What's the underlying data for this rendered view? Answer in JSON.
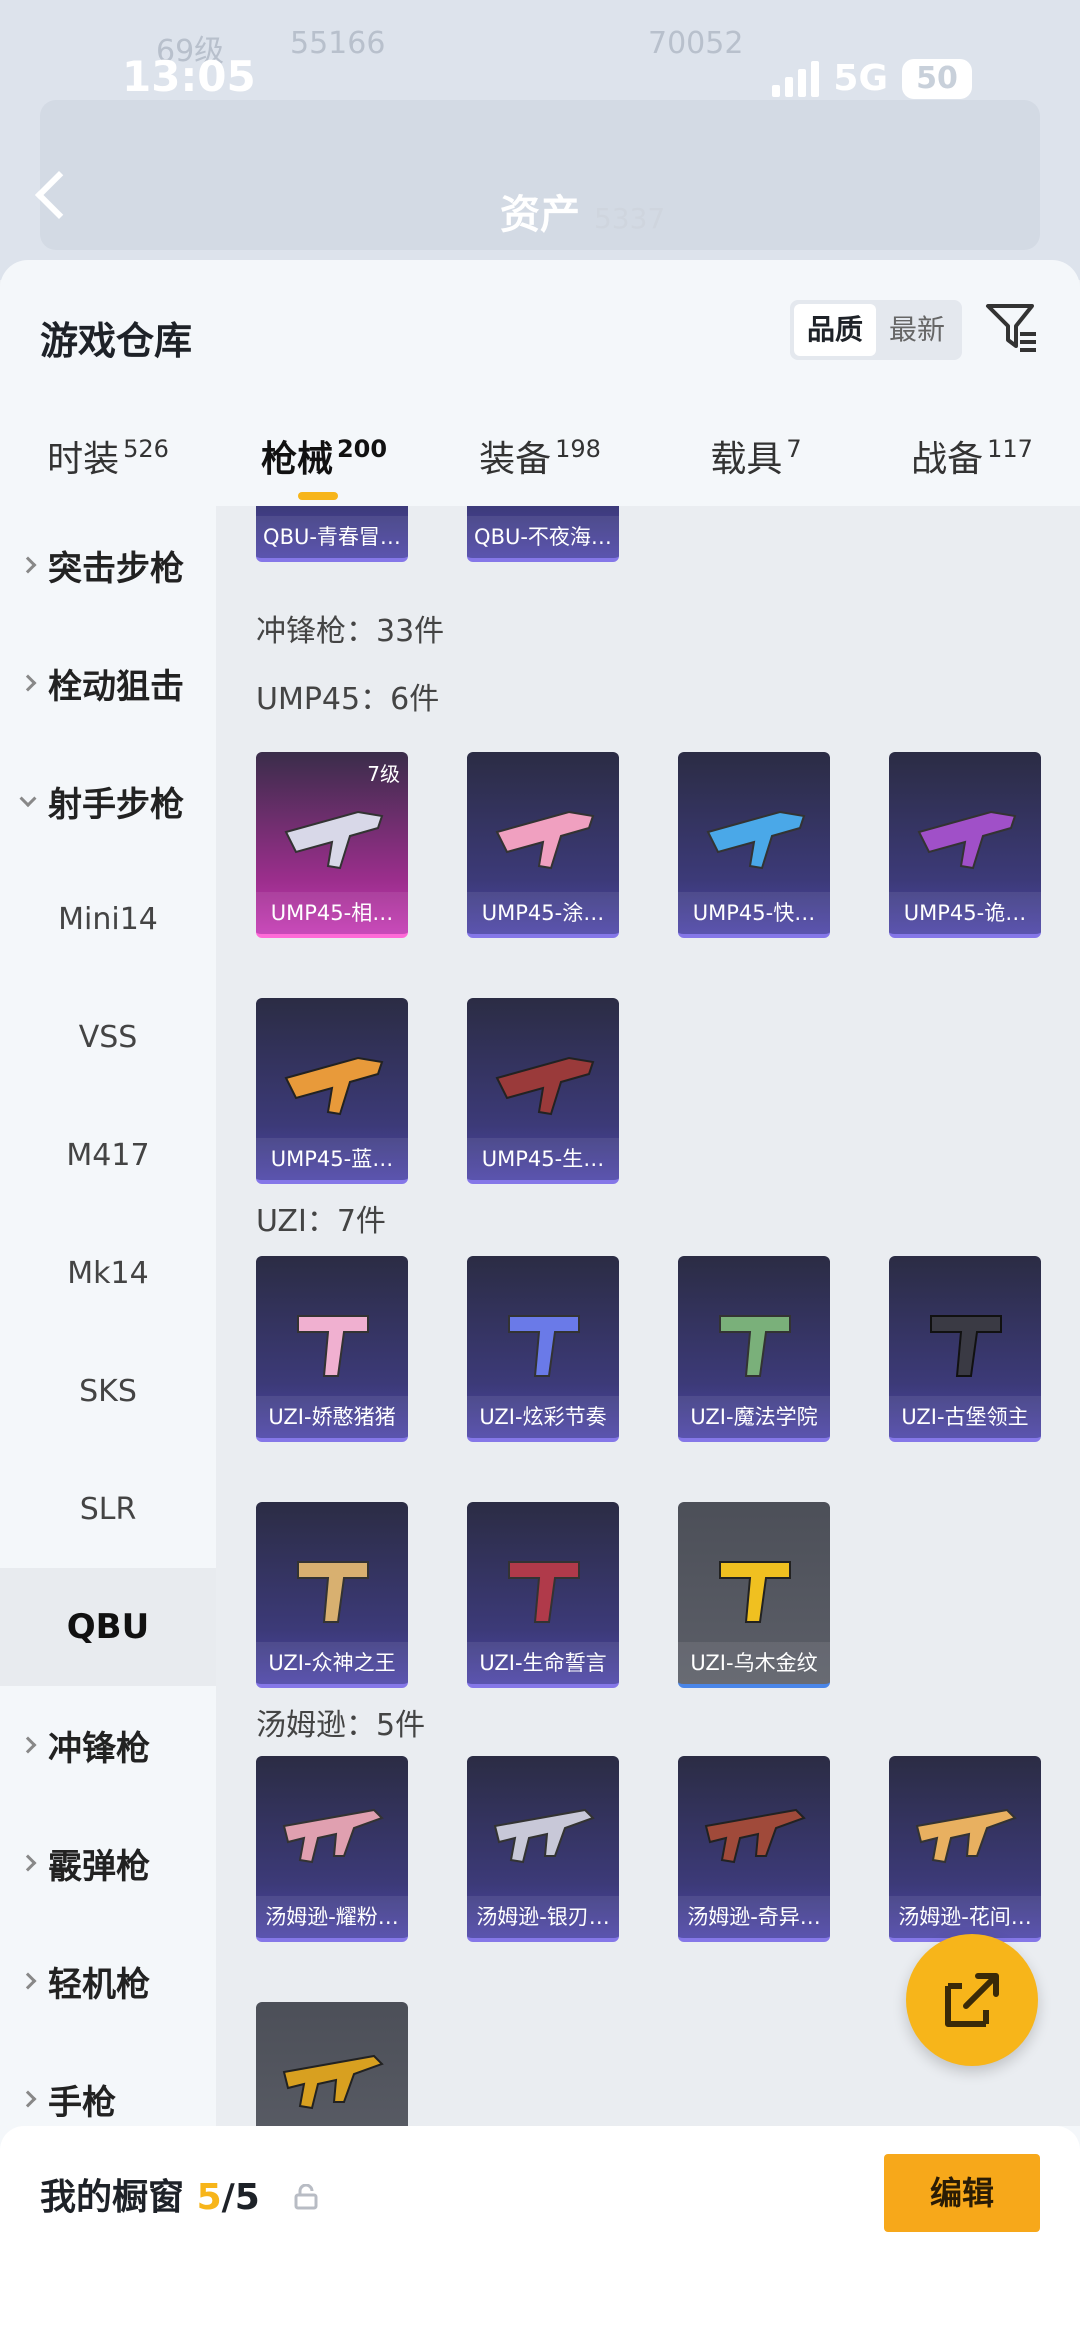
{
  "status_bar": {
    "time": "13:05",
    "network": "5G",
    "battery": "50"
  },
  "background": {
    "level_text": "69级",
    "coins": "55166",
    "score": "70052",
    "assets_label": "资产",
    "assets_value": "5337"
  },
  "header": {
    "title": "游戏仓库",
    "sort_options": [
      "品质",
      "最新"
    ],
    "active_sort": "品质"
  },
  "tabs": [
    {
      "label": "时装",
      "count": "526"
    },
    {
      "label": "枪械",
      "count": "200"
    },
    {
      "label": "装备",
      "count": "198"
    },
    {
      "label": "载具",
      "count": "7"
    },
    {
      "label": "战备",
      "count": "117"
    }
  ],
  "sidebar": [
    {
      "label": "突击步枪"
    },
    {
      "label": "栓动狙击"
    },
    {
      "label": "射手步枪"
    },
    {
      "label": "Mini14"
    },
    {
      "label": "VSS"
    },
    {
      "label": "M417"
    },
    {
      "label": "Mk14"
    },
    {
      "label": "SKS"
    },
    {
      "label": "SLR"
    },
    {
      "label": "QBU"
    },
    {
      "label": "冲锋枪"
    },
    {
      "label": "霰弹枪"
    },
    {
      "label": "轻机枪"
    },
    {
      "label": "手枪"
    }
  ],
  "content": {
    "qbu_items": [
      "QBU-青春冒…",
      "QBU-不夜海…"
    ],
    "smg_header": "冲锋枪：33件",
    "ump_header": "UMP45：6件",
    "ump_items": [
      "UMP45-相…",
      "UMP45-涂…",
      "UMP45-快…",
      "UMP45-诡…",
      "UMP45-蓝…",
      "UMP45-生…"
    ],
    "ump_level": "7级",
    "uzi_header": "UZI：7件",
    "uzi_items": [
      "UZI-娇憨猪猪",
      "UZI-炫彩节奏",
      "UZI-魔法学院",
      "UZI-古堡领主",
      "UZI-众神之王",
      "UZI-生命誓言",
      "UZI-乌木金纹"
    ],
    "tommy_header": "汤姆逊：5件",
    "tommy_items": [
      "汤姆逊-耀粉…",
      "汤姆逊-银刃…",
      "汤姆逊-奇异…",
      "汤姆逊-花间…"
    ]
  },
  "bottom": {
    "showcase_label": "我的橱窗",
    "showcase_count": "5",
    "showcase_total": "/5",
    "edit_label": "编辑"
  },
  "colors": {
    "accent": "#f7b51a",
    "card_purple": "#3c3a78",
    "card_pink": "#c43bb4",
    "card_gray": "#5c5f68"
  }
}
